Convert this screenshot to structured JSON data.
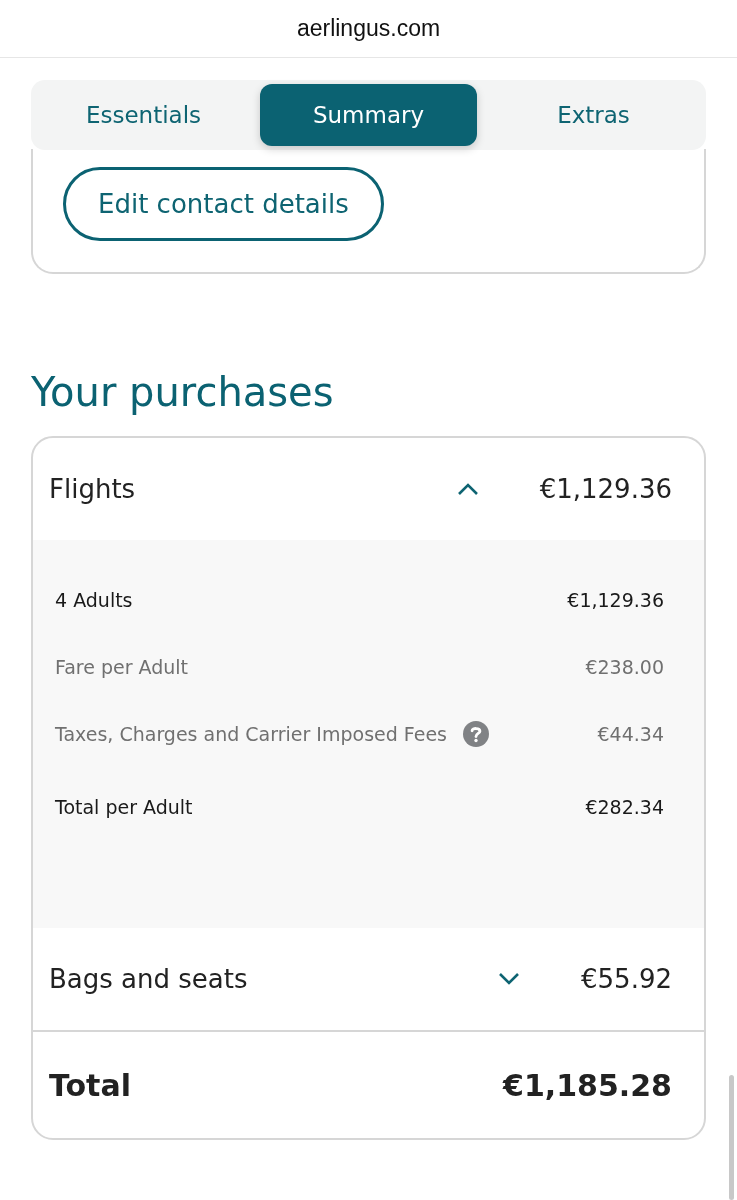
{
  "address_bar": {
    "url": "aerlingus.com"
  },
  "tabs": [
    {
      "label": "Essentials",
      "selected": false
    },
    {
      "label": "Summary",
      "selected": true
    },
    {
      "label": "Extras",
      "selected": false
    }
  ],
  "contact_card": {
    "button": "Edit contact details"
  },
  "purchases": {
    "title": "Your purchases",
    "sections": [
      {
        "label": "Flights",
        "amount": "€1,129.36",
        "expanded": true,
        "items": [
          {
            "label": "4 Adults",
            "amount": "€1,129.36",
            "kind": "summary",
            "has_help": false
          },
          {
            "label": "Fare per Adult",
            "amount": "€238.00",
            "kind": "detail",
            "has_help": false
          },
          {
            "label": "Taxes, Charges and Carrier Imposed Fees",
            "amount": "€44.34",
            "kind": "detail",
            "has_help": true
          },
          {
            "label": "Total per Adult",
            "amount": "€282.34",
            "kind": "summary",
            "has_help": false
          }
        ]
      },
      {
        "label": "Bags and seats",
        "amount": "€55.92",
        "expanded": false
      }
    ],
    "total": {
      "label": "Total",
      "amount": "€1,185.28"
    }
  }
}
